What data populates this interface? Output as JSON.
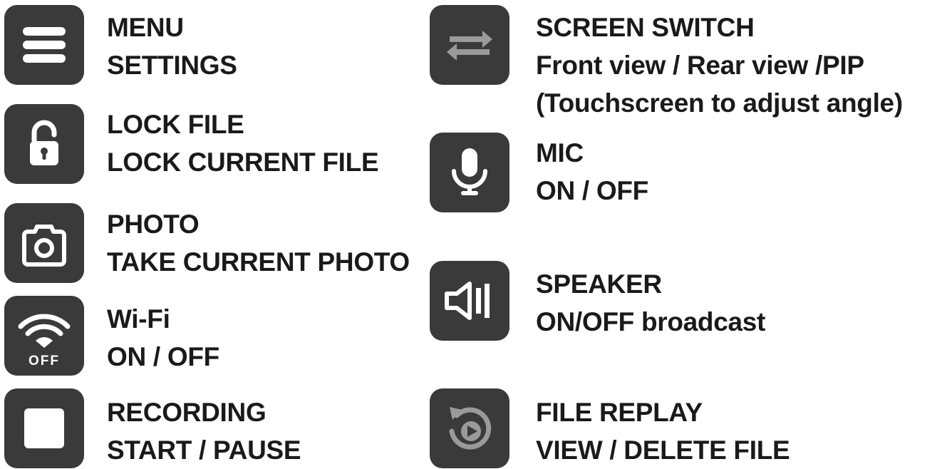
{
  "colors": {
    "icon_bg": "#3a3a3a",
    "icon_fg": "#ffffff",
    "icon_dim": "#9a9a9a",
    "text": "#1a1a1a"
  },
  "left_items": [
    {
      "icon": "hamburger-menu-icon",
      "title": "MENU",
      "lines": [
        "SETTINGS"
      ]
    },
    {
      "icon": "unlocked-padlock-icon",
      "title": "LOCK FILE",
      "lines": [
        "LOCK CURRENT FILE"
      ]
    },
    {
      "icon": "camera-icon",
      "title": "PHOTO",
      "lines": [
        "TAKE CURRENT PHOTO"
      ]
    },
    {
      "icon": "wifi-off-icon",
      "icon_text": "OFF",
      "title": "Wi-Fi",
      "lines": [
        "ON / OFF"
      ]
    },
    {
      "icon": "stop-square-icon",
      "title": "RECORDING",
      "lines": [
        "START / PAUSE"
      ]
    }
  ],
  "right_items": [
    {
      "icon": "swap-arrows-icon",
      "title": "SCREEN SWITCH",
      "lines": [
        "Front view / Rear view /PIP",
        "(Touchscreen to adjust angle)"
      ]
    },
    {
      "icon": "microphone-icon",
      "title": "MIC",
      "lines": [
        "ON / OFF"
      ]
    },
    {
      "icon": "speaker-icon",
      "title": "SPEAKER",
      "lines": [
        "ON/OFF broadcast"
      ]
    },
    {
      "icon": "replay-icon",
      "title": "FILE REPLAY",
      "lines": [
        "VIEW / DELETE FILE"
      ]
    }
  ]
}
